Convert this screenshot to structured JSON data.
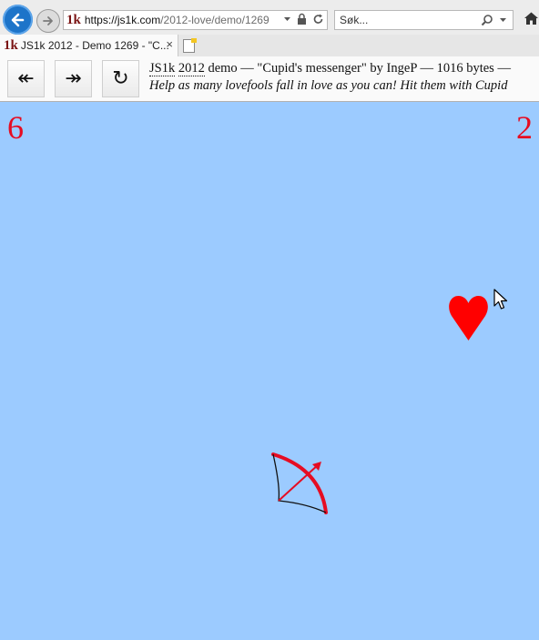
{
  "browser": {
    "url_host": "https://js1k.com",
    "url_path": "/2012-love/demo/1269",
    "site_logo": "1k",
    "search_placeholder": "Søk...",
    "tab_title": "JS1k 2012 - Demo 1269 - \"C...",
    "tab_close": "×"
  },
  "toolbar": {
    "back_label": "↞",
    "forward_label": "↠",
    "reload_label": "↻",
    "js1k": "JS1k",
    "year": "2012",
    "title_rest": " demo — \"Cupid's messenger\" by IngeP — 1016 bytes —",
    "description": "Help as many lovefools fall in love as you can! Hit them with Cupid"
  },
  "game": {
    "score_left": "6",
    "score_right": "2",
    "background": "#9ccbff",
    "accent": "#e60c22"
  }
}
